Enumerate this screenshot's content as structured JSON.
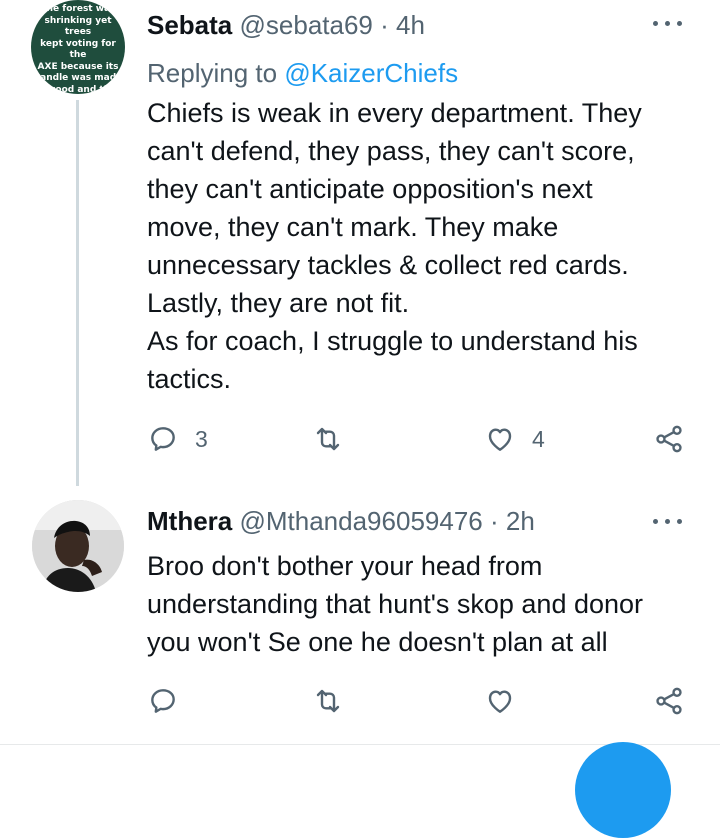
{
  "tweets": [
    {
      "name": "Sebata",
      "handle": "@sebata69",
      "time": "4h",
      "replying_label": "Replying to",
      "replying_to": "@KaizerChiefs",
      "text": "Chiefs is weak in every department. They\ncan't defend, they pass, they can't score,\nthey can't anticipate opposition's next\nmove, they can't mark. They make\nunnecessary tackles & collect red cards.\nLastly, they are not fit.\nAs for coach, I struggle to understand his\ntactics.",
      "avatar_text": "The forest was\nshrinking yet trees\nkept voting for the\nAXE because its\nhandle was made\nof wood and they\nthought it was one\nof them",
      "replies": "3",
      "retweets": "",
      "likes": "4"
    },
    {
      "name": "Mthera",
      "handle": "@Mthanda96059476",
      "time": "2h",
      "text": "Broo don't bother your head from\nunderstanding that hunt's skop and donor\nyou won't Se one he doesn't plan at all",
      "replies": "",
      "retweets": "",
      "likes": ""
    }
  ],
  "separator": "·",
  "icons": {
    "reply": "reply-icon",
    "retweet": "retweet-icon",
    "like": "heart-icon",
    "share": "share-icon",
    "more": "more-icon"
  },
  "colors": {
    "text": "#0f1419",
    "muted": "#536471",
    "link": "#1d9bf0",
    "thread_line": "#cfd9de",
    "avatar_bg": "#1f4d3d"
  }
}
